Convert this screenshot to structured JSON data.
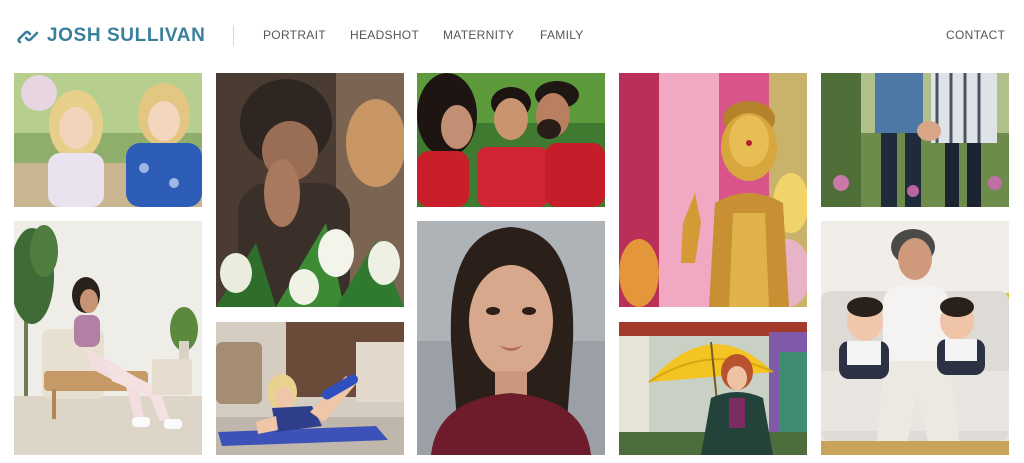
{
  "brand": {
    "name": "JOSH SULLIVAN",
    "color": "#3a7f9b"
  },
  "nav": {
    "items": [
      "PORTRAIT",
      "HEADSHOT",
      "MATERNITY",
      "FAMILY"
    ],
    "contact": "CONTACT"
  },
  "gallery": {
    "photos": [
      {
        "subject": "two young blonde girls smiling outdoors"
      },
      {
        "subject": "woman in armchair in bright living room"
      },
      {
        "subject": "blurred portrait behind white tulips"
      },
      {
        "subject": "blonde woman exercising on blue yoga mat"
      },
      {
        "subject": "family of three in red shirts against hedge"
      },
      {
        "subject": "headshot of woman in maroon top"
      },
      {
        "subject": "golden buddha statue with colorful fabrics"
      },
      {
        "subject": "woman with yellow paper umbrella"
      },
      {
        "subject": "couple holding hands among flowers"
      },
      {
        "subject": "grandmother with two babies on sofa"
      }
    ]
  }
}
